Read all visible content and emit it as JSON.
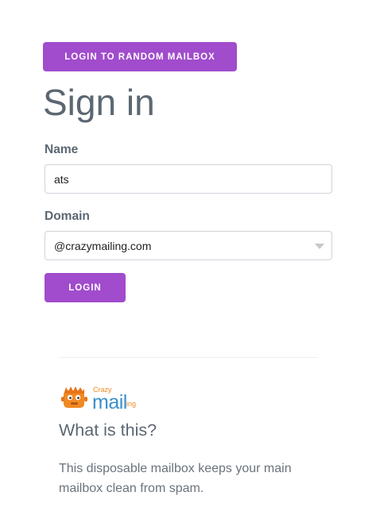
{
  "buttons": {
    "random_mailbox": "LOGIN TO RANDOM MAILBOX",
    "login": "LOGIN"
  },
  "page_title": "Sign in",
  "form": {
    "name_label": "Name",
    "name_value": "ats",
    "domain_label": "Domain",
    "domain_value": "@crazymailing.com"
  },
  "logo": {
    "crazy": "Crazy",
    "mail": "mail",
    "ing": "ing",
    "icon": "orange-monster-icon"
  },
  "info": {
    "heading": "What is this?",
    "description": "This disposable mailbox keeps your main mailbox clean from spam."
  },
  "colors": {
    "accent": "#a04ccc",
    "logo_orange": "#f08a24",
    "logo_blue": "#3a8fcb"
  }
}
